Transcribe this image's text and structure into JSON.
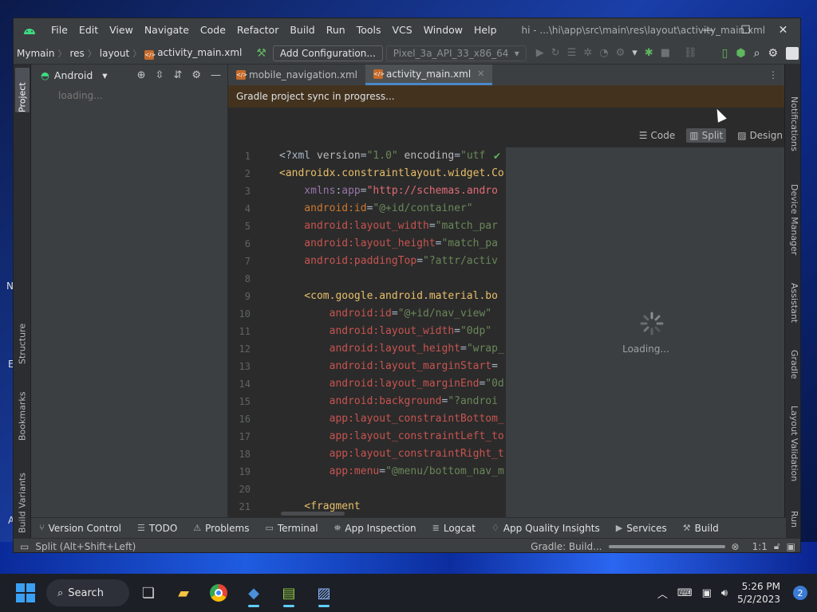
{
  "desktop": {
    "peek_left_1": "N",
    "peek_left_2": "E",
    "peek_left_3": "A"
  },
  "window": {
    "path": "hi - ...\\hi\\app\\src\\main\\res\\layout\\activity_main.xml",
    "menu": [
      "File",
      "Edit",
      "View",
      "Navigate",
      "Code",
      "Refactor",
      "Build",
      "Run",
      "Tools",
      "VCS",
      "Window",
      "Help"
    ]
  },
  "navbar": {
    "crumbs": [
      "Mymain",
      "res",
      "layout",
      "activity_main.xml"
    ],
    "config_label": "Add Configuration...",
    "device_label": "Pixel_3a_API_33_x86_64"
  },
  "project_panel": {
    "view_label": "Android",
    "loading": "loading..."
  },
  "left_tabs": {
    "project": "Project",
    "structure": "Structure",
    "bookmarks": "Bookmarks",
    "build_variants": "Build Variants"
  },
  "right_tabs": {
    "notifications": "Notifications",
    "device_manager": "Device Manager",
    "assistant": "Assistant",
    "gradle": "Gradle",
    "layout_validation": "Layout Validation",
    "run": "Run"
  },
  "editor": {
    "tabs": [
      {
        "label": "mobile_navigation.xml"
      },
      {
        "label": "activity_main.xml"
      }
    ],
    "banner": "Gradle project sync in progress...",
    "views": {
      "code": "Code",
      "split": "Split",
      "design": "Design"
    },
    "line_numbers": [
      "1",
      "2",
      "3",
      "4",
      "5",
      "6",
      "7",
      "8",
      "9",
      "10",
      "11",
      "12",
      "13",
      "14",
      "15",
      "16",
      "17",
      "18",
      "19",
      "20",
      "21"
    ],
    "code_lines": [
      [
        {
          "c": "t-punc",
          "t": "<?xml "
        },
        {
          "c": "t-attr",
          "t": "version"
        },
        {
          "c": "t-punc",
          "t": "="
        },
        {
          "c": "t-str",
          "t": "\"1.0\""
        },
        {
          "c": "t-attr",
          "t": " encoding"
        },
        {
          "c": "t-punc",
          "t": "="
        },
        {
          "c": "t-str",
          "t": "\"utf"
        }
      ],
      [
        {
          "c": "t-tag",
          "t": "<androidx.constraintlayout.widget.Co"
        }
      ],
      [
        {
          "c": "t-ns",
          "t": "    xmlns"
        },
        {
          "c": "t-punc",
          "t": ":"
        },
        {
          "c": "t-ns",
          "t": "app"
        },
        {
          "c": "t-punc",
          "t": "="
        },
        {
          "c": "t-url",
          "t": "\"http://schemas.andro"
        }
      ],
      [
        {
          "c": "t-andr",
          "t": "    android:id"
        },
        {
          "c": "t-punc",
          "t": "="
        },
        {
          "c": "t-str",
          "t": "\"@+id/container\""
        }
      ],
      [
        {
          "c": "t-red",
          "t": "    android:layout_width"
        },
        {
          "c": "t-punc",
          "t": "="
        },
        {
          "c": "t-str",
          "t": "\"match_par"
        }
      ],
      [
        {
          "c": "t-red",
          "t": "    android:layout_height"
        },
        {
          "c": "t-punc",
          "t": "="
        },
        {
          "c": "t-str",
          "t": "\"match_pa"
        }
      ],
      [
        {
          "c": "t-red",
          "t": "    android:paddingTop"
        },
        {
          "c": "t-punc",
          "t": "="
        },
        {
          "c": "t-str",
          "t": "\"?attr/activ"
        }
      ],
      [
        {
          "c": "t-punc",
          "t": ""
        }
      ],
      [
        {
          "c": "t-tag",
          "t": "    <com.google.android.material.bo"
        }
      ],
      [
        {
          "c": "t-red",
          "t": "        android:id"
        },
        {
          "c": "t-punc",
          "t": "="
        },
        {
          "c": "t-str",
          "t": "\"@+id/nav_view\""
        }
      ],
      [
        {
          "c": "t-red",
          "t": "        android:layout_width"
        },
        {
          "c": "t-punc",
          "t": "="
        },
        {
          "c": "t-str",
          "t": "\"0dp\""
        }
      ],
      [
        {
          "c": "t-red",
          "t": "        android:layout_height"
        },
        {
          "c": "t-punc",
          "t": "="
        },
        {
          "c": "t-str",
          "t": "\"wrap_"
        }
      ],
      [
        {
          "c": "t-red",
          "t": "        android:layout_marginStart"
        },
        {
          "c": "t-punc",
          "t": "="
        }
      ],
      [
        {
          "c": "t-red",
          "t": "        android:layout_marginEnd"
        },
        {
          "c": "t-punc",
          "t": "="
        },
        {
          "c": "t-str",
          "t": "\"0d"
        }
      ],
      [
        {
          "c": "t-red",
          "t": "        android:background"
        },
        {
          "c": "t-punc",
          "t": "="
        },
        {
          "c": "t-str",
          "t": "\"?androi"
        }
      ],
      [
        {
          "c": "t-red",
          "t": "        app:layout_constraintBottom_"
        }
      ],
      [
        {
          "c": "t-red",
          "t": "        app:layout_constraintLeft_to"
        }
      ],
      [
        {
          "c": "t-red",
          "t": "        app:layout_constraintRight_t"
        }
      ],
      [
        {
          "c": "t-red",
          "t": "        app:menu"
        },
        {
          "c": "t-punc",
          "t": "="
        },
        {
          "c": "t-str",
          "t": "\"@menu/bottom_nav_m"
        }
      ],
      [
        {
          "c": "t-punc",
          "t": ""
        }
      ],
      [
        {
          "c": "t-tag",
          "t": "    <fragment"
        }
      ]
    ],
    "preview_loading": "Loading..."
  },
  "bottom_tools": [
    {
      "icon": "branch",
      "label": "Version Control"
    },
    {
      "icon": "list",
      "label": "TODO"
    },
    {
      "icon": "warn",
      "label": "Problems"
    },
    {
      "icon": "term",
      "label": "Terminal"
    },
    {
      "icon": "inspect",
      "label": "App Inspection"
    },
    {
      "icon": "log",
      "label": "Logcat"
    },
    {
      "icon": "quality",
      "label": "App Quality Insights"
    },
    {
      "icon": "services",
      "label": "Services"
    },
    {
      "icon": "build",
      "label": "Build"
    }
  ],
  "status": {
    "hint": "Split (Alt+Shift+Left)",
    "gradle": "Gradle: Build...",
    "progress": 1.0,
    "zoom": "1:1"
  },
  "taskbar": {
    "search": "Search",
    "time": "5:26 PM",
    "date": "5/2/2023",
    "badge": "2"
  }
}
